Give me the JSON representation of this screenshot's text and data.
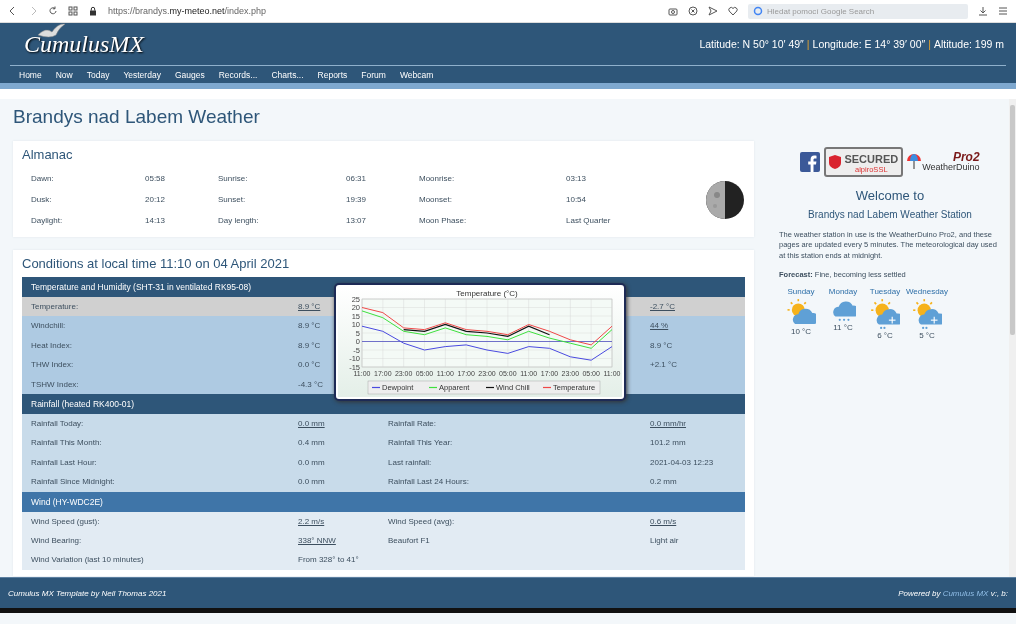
{
  "browser": {
    "url_prefix": "https://brandys.",
    "url_domain": "my-meteo.net",
    "url_path": "/index.php",
    "search_placeholder": "Hledat pomocí Google Search"
  },
  "header": {
    "logo": "CumulusMX",
    "separator": "|",
    "location": [
      "Latitude: N 50° 10′ 49″",
      "Longitude: E 14° 39′ 00″",
      "Altitude: 199 m"
    ]
  },
  "nav": [
    "Home",
    "Now",
    "Today",
    "Yesterday",
    "Gauges",
    "Records...",
    "Charts...",
    "Reports",
    "Forum",
    "Webcam"
  ],
  "page_title": "Brandys nad Labem Weather",
  "almanac": {
    "title": "Almanac",
    "rows": [
      {
        "cells": [
          "Dawn:",
          "05:58",
          "Sunrise:",
          "06:31",
          "Moonrise:",
          "03:13"
        ]
      },
      {
        "cells": [
          "Dusk:",
          "20:12",
          "Sunset:",
          "19:39",
          "Moonset:",
          "10:54"
        ]
      },
      {
        "cells": [
          "Daylight:",
          "14:13",
          "Day length:",
          "13:07",
          "Moon Phase:",
          "Last Quarter"
        ]
      }
    ]
  },
  "conditions": {
    "title": "Conditions at local time 11:10 on 04 April 2021",
    "sections": [
      {
        "kind": "temperature",
        "title": "Temperature and Humidity (SHT-31 in ventilated RK95-08)",
        "rows": [
          {
            "label": "Temperature:",
            "value": "8.9 °C",
            "value_link": true,
            "value2": "-2.7 °C",
            "value2_link": true,
            "highlighted": true
          },
          {
            "label": "Windchill:",
            "value": "8.9 °C",
            "value_link": false,
            "value2": "44 %",
            "value2_link": true,
            "highlighted": false
          },
          {
            "label": "Heat Index:",
            "value": "8.9 °C",
            "value_link": false,
            "value2": "8.9 °C",
            "value2_link": false,
            "highlighted": false
          },
          {
            "label": "THW Index:",
            "value": "0.0 °C",
            "value_link": false,
            "value2": "+2.1 °C",
            "value2_link": false,
            "highlighted": false
          },
          {
            "label": "TSHW Index:",
            "value": "-4.3 °C",
            "value_link": false,
            "highlighted": false
          }
        ]
      },
      {
        "kind": "rain",
        "title": "Rainfall (heated RK400-01)",
        "rows": [
          {
            "label": "Rainfall Today:",
            "value": "0.0 mm",
            "value_link": true,
            "label2": "Rainfall Rate:",
            "value2": "0.0 mm/hr",
            "value2_link": true,
            "highlighted": false
          },
          {
            "label": "Rainfall This Month:",
            "value": "0.4 mm",
            "value_link": false,
            "label2": "Rainfall This Year:",
            "value2": "101.2 mm",
            "value2_link": false,
            "highlighted": false
          },
          {
            "label": "Rainfall Last Hour:",
            "value": "0.0 mm",
            "value_link": false,
            "label2": "Last rainfall:",
            "value2": "2021-04-03 12:23",
            "value2_link": false,
            "highlighted": false
          },
          {
            "label": "Rainfall Since Midnight:",
            "value": "0.0 mm",
            "value_link": false,
            "label2": "Rainfall Last 24 Hours:",
            "value2": "0.2 mm",
            "value2_link": false,
            "highlighted": false
          }
        ]
      },
      {
        "kind": "wind",
        "title": "Wind (HY-WDC2E)",
        "rows": [
          {
            "label": "Wind Speed (gust):",
            "value": "2.2 m/s",
            "value_link": true,
            "label2": "Wind Speed (avg):",
            "value2": "0.6 m/s",
            "value2_link": true,
            "highlighted": false
          },
          {
            "label": "Wind Bearing:",
            "value": "338° NNW",
            "value_link": true,
            "label2": "Beaufort F1",
            "value2": "Light air",
            "value2_link": false,
            "highlighted": false
          },
          {
            "label": "Wind Variation (last 10 minutes)",
            "value": "From 328° to 41°",
            "value_link": false,
            "highlighted": false
          }
        ]
      }
    ]
  },
  "tooltip_chart": {
    "chart_data": {
      "type": "line",
      "title": "Temperature (°C)",
      "grid": true,
      "legend": "bottom",
      "ref_lines": [
        {
          "axis": "y",
          "value": 0,
          "color": "#5050c0"
        }
      ],
      "categories": [
        "11:00",
        "17:00",
        "23:00",
        "05:00",
        "11:00",
        "17:00",
        "23:00",
        "05:00",
        "11:00",
        "17:00",
        "23:00",
        "05:00",
        "11:00"
      ],
      "ylim": [
        -15,
        25
      ],
      "yticks": [
        -15,
        -10,
        -5,
        0,
        5,
        10,
        15,
        20,
        25
      ],
      "series": [
        {
          "name": "Dewpoint",
          "color": "#4a4ae0",
          "values": [
            9,
            6,
            -1,
            -5,
            -3,
            -2,
            -5,
            -7,
            -3,
            -4,
            -9,
            -11,
            -3
          ]
        },
        {
          "name": "Apparent",
          "color": "#3ee03e",
          "values": [
            18,
            14,
            6,
            4,
            8,
            4,
            3,
            1,
            6,
            2,
            -1,
            -4,
            7
          ]
        },
        {
          "name": "Wind Chill",
          "color": "#111111",
          "values": [
            null,
            null,
            7,
            6,
            10,
            6,
            5,
            3,
            9,
            4,
            null,
            null,
            null
          ]
        },
        {
          "name": "Temperature",
          "color": "#f04848",
          "values": [
            20,
            17,
            8,
            7,
            11,
            7,
            6,
            4,
            10,
            6,
            1,
            -2,
            9
          ]
        }
      ]
    }
  },
  "sidebar": {
    "badges": {
      "secured": "SECURED",
      "ssl": "alpiroSSL",
      "pro": "Pro2",
      "duino": "WeatherDuino"
    },
    "welcome": "Welcome to",
    "station": "Brandys nad Labem Weather Station",
    "description": "The weather station in use is the WeatherDuino Pro2, and these pages are updated every 5 minutes. The meteorological day used at this station ends at midnight.",
    "forecast": "**Forecast:** Fine, becoming less settled",
    "days": [
      {
        "day": "Sunday",
        "kind": "sun_cloud",
        "temp": "10 °C"
      },
      {
        "day": "Monday",
        "kind": "rain",
        "temp": "11 °C"
      },
      {
        "day": "Tuesday",
        "kind": "sun_snow",
        "temp": "6 °C"
      },
      {
        "day": "Wednesday",
        "kind": "sun_snow",
        "temp": "5 °C"
      }
    ]
  },
  "footer": {
    "left": "Cumulus MX Template by Neil Thomas 2021",
    "right_prefix": "Powered by",
    "right_link": "Cumulus MX",
    "right_suffix": "v:, b:"
  }
}
